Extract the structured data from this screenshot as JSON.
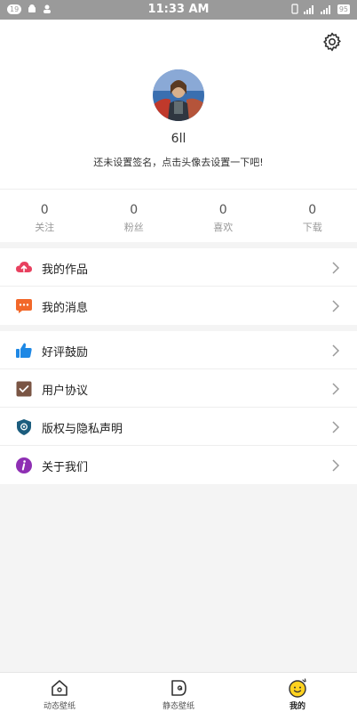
{
  "status_bar": {
    "notification_count": "19",
    "time": "11:33 AM",
    "battery": "95"
  },
  "profile": {
    "username": "6ll",
    "signature": "还未设置签名，点击头像去设置一下吧!"
  },
  "stats": [
    {
      "value": "0",
      "label": "关注"
    },
    {
      "value": "0",
      "label": "粉丝"
    },
    {
      "value": "0",
      "label": "喜欢"
    },
    {
      "value": "0",
      "label": "下载"
    }
  ],
  "menu": {
    "my_works": "我的作品",
    "my_messages": "我的消息",
    "rate_us": "好评鼓励",
    "user_agreement": "用户协议",
    "copyright_privacy": "版权与隐私声明",
    "about_us": "关于我们"
  },
  "tabs": [
    {
      "label": "动态壁纸"
    },
    {
      "label": "静态壁纸"
    },
    {
      "label": "我的"
    }
  ],
  "colors": {
    "upload": "#e8415f",
    "message": "#f2682a",
    "thumbs": "#1e88e5",
    "agreement": "#7a5544",
    "shield": "#1c5d7e",
    "about": "#8e2fb3",
    "active_tab": "#ffd21f"
  }
}
